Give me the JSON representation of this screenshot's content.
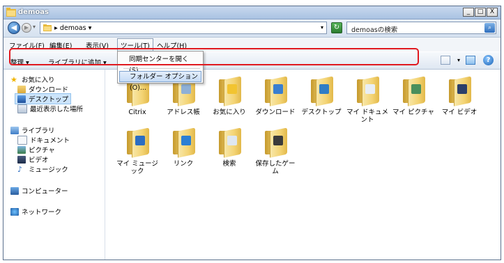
{
  "window": {
    "title": "demoas",
    "controls": {
      "minimize": "_",
      "maximize": "□",
      "close": "X"
    }
  },
  "address_bar": {
    "back_glyph": "◀",
    "forward_glyph": "▶",
    "path_separator": "▸",
    "path": "demoas",
    "dropdown_glyph": "▾",
    "refresh_glyph": "↻",
    "search_placeholder": "demoasの検索",
    "search_icon": "search-icon"
  },
  "menubar": {
    "items": [
      "ファイル(F)",
      "編集(E)",
      "表示(V)",
      "ツール(T)",
      "ヘルプ(H)"
    ],
    "active_index": 3
  },
  "tools_menu": {
    "items": [
      "同期センターを開く(S)...",
      "フォルダー オプション(O)..."
    ],
    "selected_index": 1
  },
  "toolbar": {
    "organize": "整理 ▾",
    "add_to_library": "ライブラリに追加 ▾",
    "help": "?"
  },
  "sidebar": {
    "favorites": "お気に入り",
    "downloads": "ダウンロード",
    "desktop": "デスクトップ",
    "recent": "最近表示した場所",
    "libraries": "ライブラリ",
    "documents": "ドキュメント",
    "pictures": "ピクチャ",
    "videos": "ビデオ",
    "music": "ミュージック",
    "computer": "コンピューター",
    "network": "ネットワーク"
  },
  "folders": [
    {
      "name": "Citrix",
      "icon": "citrix-folder-icon",
      "emblem": ""
    },
    {
      "name": "アドレス帳",
      "icon": "contacts-folder-icon",
      "emblem": "#8fb0d6"
    },
    {
      "name": "お気に入り",
      "icon": "favorites-folder-icon",
      "emblem": "#f2c431"
    },
    {
      "name": "ダウンロード",
      "icon": "downloads-folder-icon",
      "emblem": "#3a7fd0"
    },
    {
      "name": "デスクトップ",
      "icon": "desktop-folder-icon",
      "emblem": "#2f7dc6"
    },
    {
      "name": "マイ ドキュメント",
      "icon": "documents-folder-icon",
      "emblem": "#e8eef6"
    },
    {
      "name": "マイ ピクチャ",
      "icon": "pictures-folder-icon",
      "emblem": "#4a8f5c"
    },
    {
      "name": "マイ ビデオ",
      "icon": "videos-folder-icon",
      "emblem": "#2b3f6a"
    },
    {
      "name": "マイ ミュージック",
      "icon": "music-folder-icon",
      "emblem": "#2c6dc2"
    },
    {
      "name": "リンク",
      "icon": "links-folder-icon",
      "emblem": "#2b7fd4"
    },
    {
      "name": "検索",
      "icon": "searches-folder-icon",
      "emblem": "#dfe7f0"
    },
    {
      "name": "保存したゲーム",
      "icon": "saved-games-folder-icon",
      "emblem": "#3b3b3b"
    }
  ],
  "colors": {
    "highlight_box": "#e0191f",
    "selection": "#cce4fb"
  }
}
